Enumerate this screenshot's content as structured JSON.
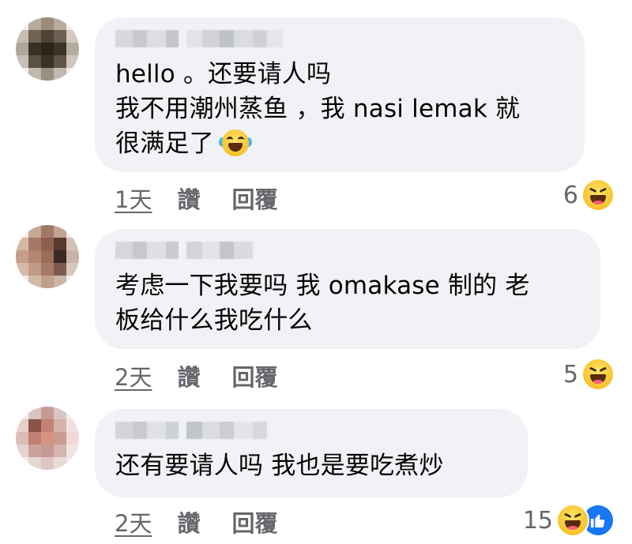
{
  "comments": [
    {
      "text_lines": [
        "hello 。还要请人吗",
        "我不用潮州蒸鱼 ，我 nasi lemak 就",
        "很满足了"
      ],
      "inline_emoji": "tears-of-joy-emoji",
      "time": "1天",
      "like_label": "讚",
      "reply_label": "回覆",
      "reaction_count": "6",
      "reactions": [
        "haha-emoji"
      ],
      "avatar_colors": [
        [
          "#f1ede9",
          "#b9ab9c",
          "#9a8b7b",
          "#b9ad9f",
          "#f1ede9"
        ],
        [
          "#c8bcb0",
          "#6f6354",
          "#4e4336",
          "#6c5f51",
          "#d3c9bf"
        ],
        [
          "#b0a597",
          "#3a3126",
          "#2c241a",
          "#3c3328",
          "#b7ab9e"
        ],
        [
          "#c7bfb5",
          "#5a5044",
          "#3b3226",
          "#5d5346",
          "#cfc6bc"
        ],
        [
          "#f1ede9",
          "#c2b7ac",
          "#9a8f82",
          "#c2b8ad",
          "#f1ede9"
        ]
      ],
      "name_blur_colors": [
        "#d6d8dc",
        "#c7c9ce",
        "#dcdee2",
        "#c4c6cb",
        "#e3e4e7",
        "#d0d2d6",
        "#bfc2c7",
        "#dadce0",
        "#cfd1d5",
        "#e5e6e9"
      ]
    },
    {
      "text_lines": [
        "考虑一下我要吗 我 omakase 制的 老",
        "板给什么我吃什么"
      ],
      "time": "2天",
      "like_label": "讚",
      "reply_label": "回覆",
      "reaction_count": "5",
      "reactions": [
        "haha-emoji"
      ],
      "avatar_colors": [
        [
          "#f1ede9",
          "#c7a896",
          "#a07a67",
          "#c2a392",
          "#f1ede9"
        ],
        [
          "#d7b8a3",
          "#a27967",
          "#8c5f4c",
          "#5a3a2f",
          "#d4c1b5"
        ],
        [
          "#c69d8a",
          "#b58671",
          "#9b6c58",
          "#3b2823",
          "#c6b3a8"
        ],
        [
          "#d6bbaa",
          "#c29b87",
          "#a47a66",
          "#7d5a4c",
          "#d8c7bc"
        ],
        [
          "#f1ede9",
          "#d2baa9",
          "#bf9e8a",
          "#cbb5a7",
          "#f1ede9"
        ]
      ],
      "name_blur_colors": [
        "#d5d7db",
        "#c6c8cc",
        "#dfe0e4",
        "#c9cbcf",
        "#d2d4d8",
        "#e2e3e6",
        "#c3c5ca",
        "#d9dbdf"
      ]
    },
    {
      "text_lines": [
        "还有要请人吗 我也是要吃煮炒"
      ],
      "time": "2天",
      "like_label": "讚",
      "reply_label": "回覆",
      "reaction_count": "15",
      "reactions": [
        "haha-emoji",
        "like-emoji"
      ],
      "avatar_colors": [
        [
          "#f1ede9",
          "#d9c3c3",
          "#c79a93",
          "#d9c5c4",
          "#f1ede9"
        ],
        [
          "#e6cfcc",
          "#8a5249",
          "#c28276",
          "#d7b2ac",
          "#efe1df"
        ],
        [
          "#ddbbb6",
          "#c07f72",
          "#d7937f",
          "#c89b93",
          "#eed9d6"
        ],
        [
          "#e7d2cf",
          "#caa29b",
          "#c79b93",
          "#d5b5b0",
          "#f1e3e1"
        ],
        [
          "#f1ede9",
          "#e6d6d4",
          "#dec7c3",
          "#e8dad8",
          "#f1ede9"
        ]
      ],
      "name_blur_colors": [
        "#d3d5d9",
        "#c8cace",
        "#e0e1e4",
        "#cdd0d4",
        "#c1c4c9",
        "#dadce0",
        "#cbcdd1",
        "#e4e5e8",
        "#d6d8dc"
      ]
    }
  ],
  "colors": {
    "bubble_bg": "#f0f2f5",
    "meta_text": "#65676b",
    "body_text": "#050505",
    "like_blue": "#1877f2"
  }
}
